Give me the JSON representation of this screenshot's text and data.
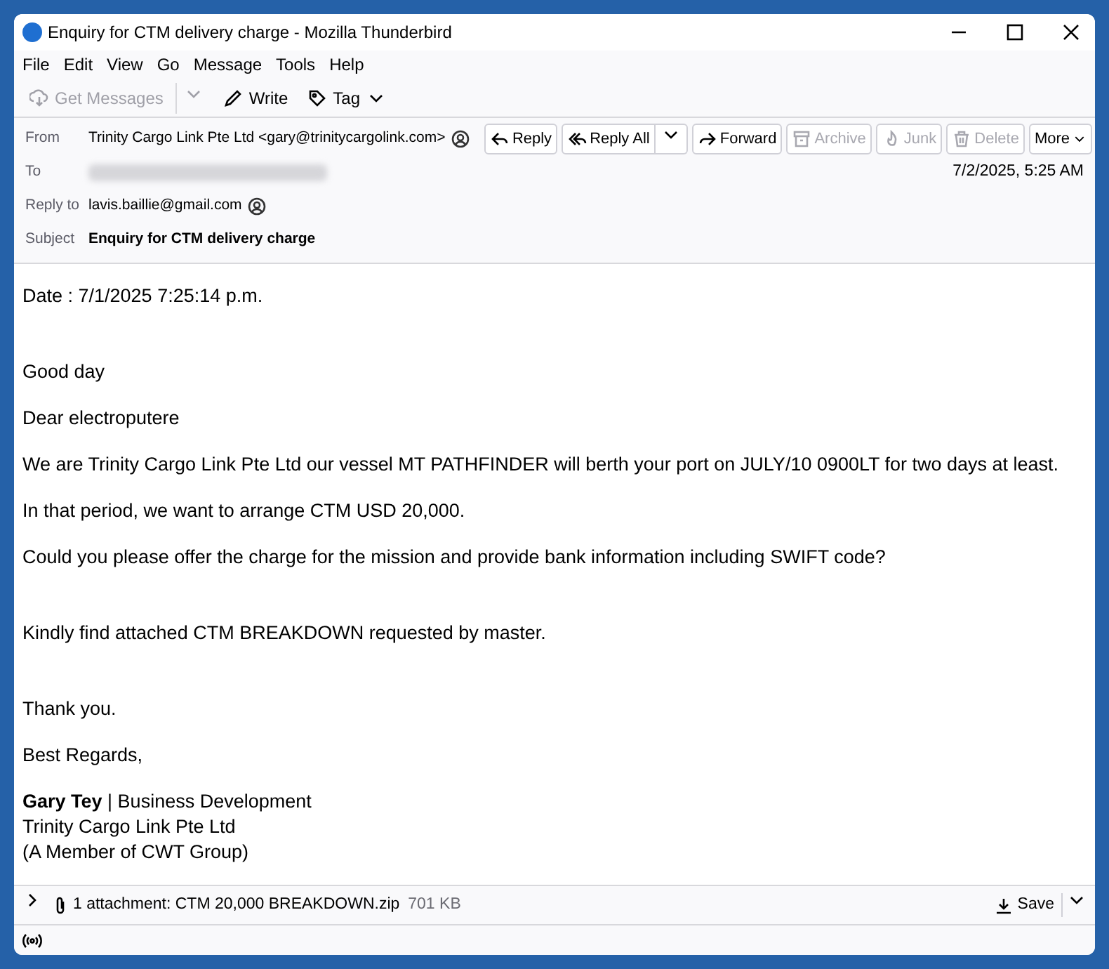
{
  "window": {
    "title": "Enquiry for CTM delivery charge - Mozilla Thunderbird"
  },
  "menu": [
    "File",
    "Edit",
    "View",
    "Go",
    "Message",
    "Tools",
    "Help"
  ],
  "toolbar": [
    {
      "label": "Get Messages",
      "kind": "get",
      "disabled": true,
      "dropdown": true
    },
    {
      "label": "Write",
      "kind": "write",
      "disabled": false,
      "dropdown": false
    },
    {
      "label": "Tag",
      "kind": "tag",
      "disabled": false,
      "dropdown": true
    }
  ],
  "header": {
    "from_label": "From",
    "from": "Trinity Cargo Link Pte Ltd <gary@trinitycargolink.com>",
    "to_label": "To",
    "date": "7/2/2025, 5:25 AM",
    "reply_to_label": "Reply to",
    "reply_to": "lavis.baillie@gmail.com",
    "subject_label": "Subject",
    "subject": "Enquiry for CTM delivery charge",
    "actions": [
      {
        "label": "Reply",
        "kind": "reply",
        "disabled": false
      },
      {
        "label": "Reply All",
        "kind": "replyall",
        "disabled": false
      },
      {
        "label": "Forward",
        "kind": "forward",
        "disabled": false
      },
      {
        "label": "Archive",
        "kind": "archive",
        "disabled": true
      },
      {
        "label": "Junk",
        "kind": "junk",
        "disabled": true
      },
      {
        "label": "Delete",
        "kind": "delete",
        "disabled": true
      },
      {
        "label": "More",
        "kind": "more",
        "disabled": false
      }
    ]
  },
  "body": {
    "paragraphs": [
      {
        "lines": [
          "Date : 7/1/2025 7:25:14 p.m."
        ]
      },
      {
        "lines": [
          "Good day"
        ]
      },
      {
        "lines": [
          "Dear electroputere"
        ]
      },
      {
        "lines": [
          "We are Trinity Cargo Link Pte Ltd our vessel MT PATHFINDER will berth your port on JULY/10 0900LT for two days at least."
        ]
      },
      {
        "lines": [
          "In that period, we want to arrange CTM USD 20,000."
        ]
      },
      {
        "lines": [
          "Could you please offer the charge for the mission and provide bank information including SWIFT code?"
        ]
      },
      {
        "lines": [
          "Kindly find attached CTM BREAKDOWN requested by master."
        ]
      },
      {
        "lines": [
          "Thank you."
        ]
      },
      {
        "lines": [
          "Best Regards,"
        ]
      },
      {
        "lines": [
          "**Gary Tey** | Business Development",
          "Trinity Cargo Link Pte Ltd",
          "(A Member of CWT Group)"
        ]
      }
    ]
  },
  "attachment": {
    "summary": "1 attachment: CTM 20,000 BREAKDOWN.zip",
    "size": "701 KB",
    "save": "Save"
  }
}
